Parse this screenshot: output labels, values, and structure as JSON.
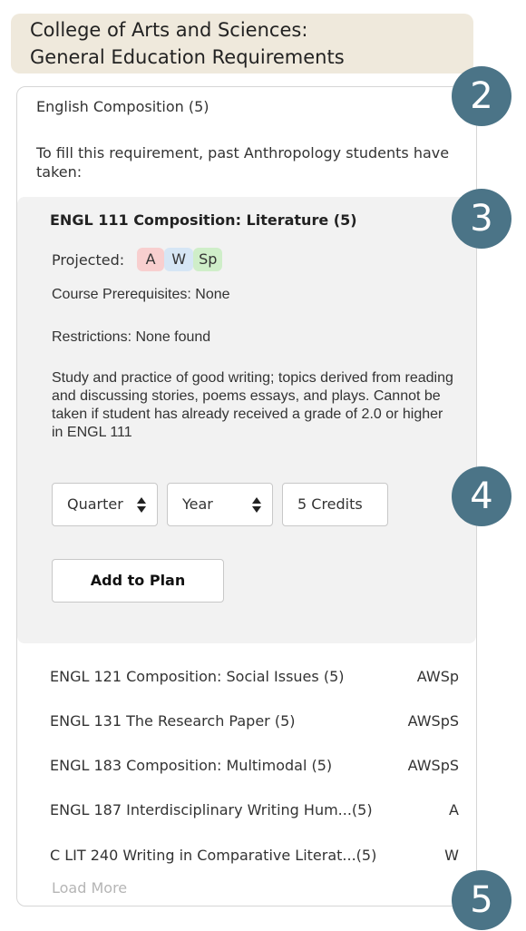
{
  "header": {
    "line1": "College of Arts and Sciences:",
    "line2": "General Education Requirements"
  },
  "requirement": {
    "title": "English Composition (5)",
    "description": "To fill this requirement, past Anthropology students have taken:"
  },
  "selected_course": {
    "title": "ENGL 111 Composition: Literature (5)",
    "projected_label": "Projected:",
    "quarters": [
      "A",
      "W",
      "Sp"
    ],
    "prerequisites": "Course Prerequisites: None",
    "restrictions": "Restrictions: None found",
    "description": "Study and practice of good writing; topics derived from reading and discussing stories, poems essays, and plays. Cannot be taken if student has already received a grade of 2.0 or higher in ENGL 111",
    "quarter_select": "Quarter",
    "year_select": "Year",
    "credits": "5 Credits",
    "add_button": "Add to Plan"
  },
  "courses": [
    {
      "name": "ENGL 121 Composition: Social Issues (5)",
      "quarters": "AWSp"
    },
    {
      "name": "ENGL 131 The Research Paper (5)",
      "quarters": "AWSpS"
    },
    {
      "name": "ENGL 183 Composition: Multimodal (5)",
      "quarters": "AWSpS"
    },
    {
      "name": "ENGL 187 Interdisciplinary Writing Hum...(5)",
      "quarters": "A"
    },
    {
      "name": "C LIT 240 Writing in Comparative Literat...(5)",
      "quarters": "W"
    }
  ],
  "load_more": "Load More",
  "steps": [
    "2",
    "3",
    "4",
    "5"
  ],
  "colors": {
    "header_bg": "#efe9dc",
    "step_badge": "#4b7487",
    "badge_autumn": "#f8cfcf",
    "badge_winter": "#d6e6f5",
    "badge_spring": "#cfeec9"
  }
}
